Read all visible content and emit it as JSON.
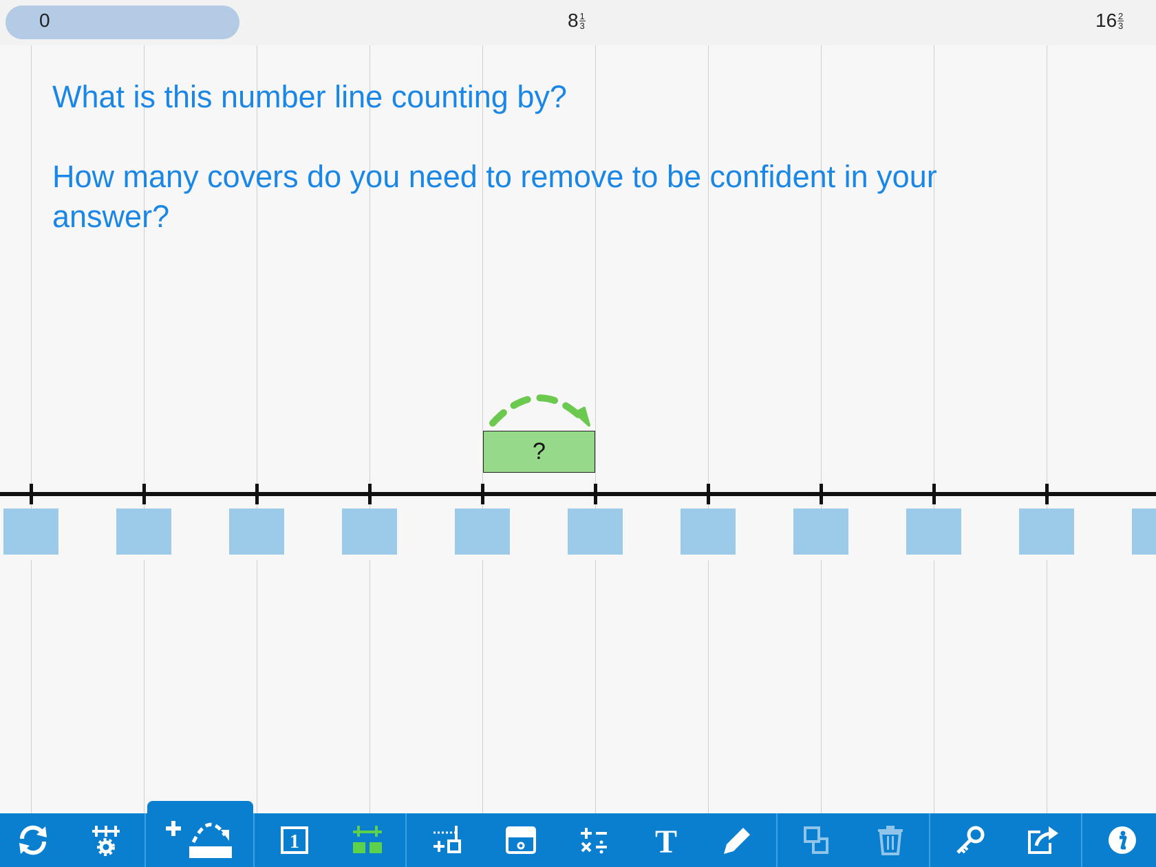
{
  "range": {
    "start_label": "0",
    "mid_whole": "8",
    "mid_num": "1",
    "mid_den": "3",
    "end_whole": "16",
    "end_num": "2",
    "end_den": "3"
  },
  "prompt": {
    "line1": "What is this number line counting by?",
    "line2": "How many covers do you need to remove to be confident in your answer?"
  },
  "jump": {
    "label": "?"
  },
  "number_line": {
    "tick_count": 10,
    "cover_count": 11
  },
  "toolbar": {
    "icons": [
      "rotate-icon",
      "line-settings-icon",
      "add-jump-icon",
      "number-tile-icon",
      "covers-icon",
      "hops-icon",
      "hide-icon",
      "operations-icon",
      "text-icon",
      "pencil-icon",
      "duplicate-icon",
      "trash-icon",
      "key-icon",
      "share-icon",
      "info-icon"
    ]
  },
  "colors": {
    "prompt": "#1a87e6",
    "toolbar": "#0a7fd0",
    "cover": "#9ccbea",
    "jump_box": "#97d98b",
    "jump_arrow": "#6cc94f",
    "active_green": "#5ed14a",
    "range_slider": "#b3cbe4"
  }
}
